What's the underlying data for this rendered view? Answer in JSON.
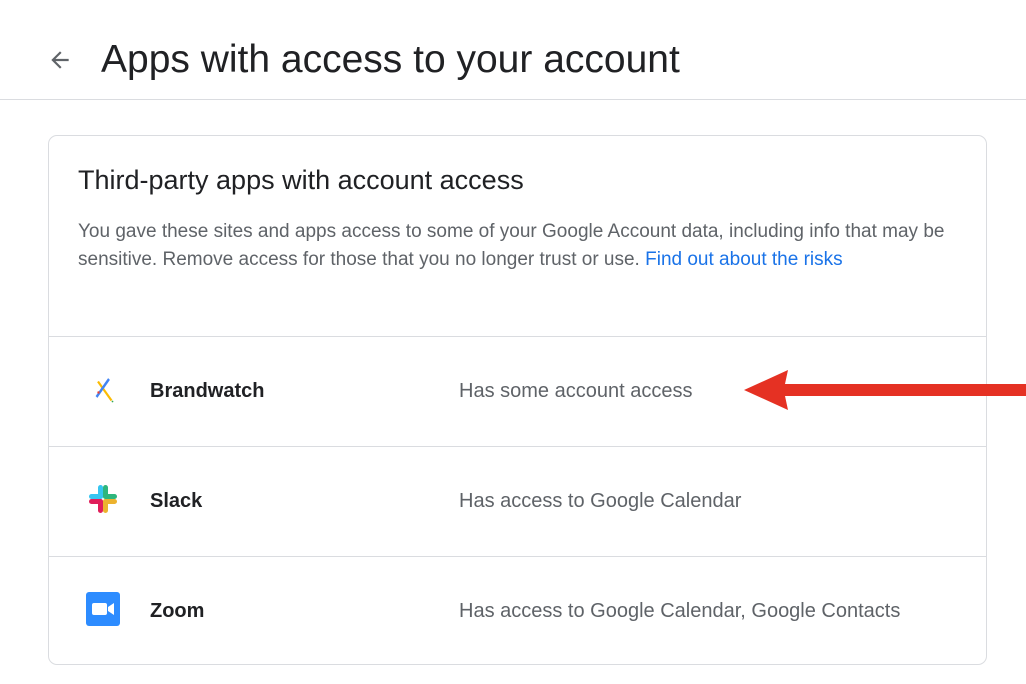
{
  "header": {
    "back_icon": "arrow-back-icon",
    "title": "Apps with access to your account"
  },
  "card": {
    "title": "Third-party apps with account access",
    "description": "You gave these sites and apps access to some of your Google Account data, including info that may be sensitive. Remove access for those that you no longer trust or use.",
    "link_text": "Find out about the risks",
    "link_color": "#1a73e8"
  },
  "apps": [
    {
      "name": "Brandwatch",
      "access": "Has some account access",
      "icon": "brandwatch-logo-icon"
    },
    {
      "name": "Slack",
      "access": "Has access to Google Calendar",
      "icon": "slack-logo-icon"
    },
    {
      "name": "Zoom",
      "access": "Has access to Google Calendar, Google Contacts",
      "icon": "zoom-logo-icon"
    }
  ],
  "annotation": {
    "type": "red-arrow",
    "color": "#e53123",
    "target": "Brandwatch"
  }
}
